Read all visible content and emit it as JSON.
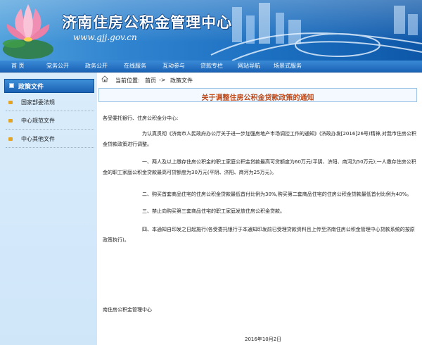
{
  "header": {
    "title": "济南住房公积金管理中心",
    "url": "www.gjj.gov.cn"
  },
  "nav": {
    "items": [
      "首 页",
      "党务公开",
      "政务公开",
      "在线服务",
      "互动参与",
      "贷款专栏",
      "网站导航",
      "场景式服务"
    ]
  },
  "sidebar": {
    "heading": "政策文件",
    "items": [
      "国家部委法规",
      "中心规范文件",
      "中心其他文件"
    ]
  },
  "breadcrumb": {
    "prefix": "当前位置:",
    "home": "首页",
    "separator": "->",
    "current": "政策文件"
  },
  "article": {
    "title": "关于调整住房公积金贷款政策的通知",
    "salutation": "各受委托银行、住房公积金分中心:",
    "intro": "为认真贯彻《济南市人民政府办公厅关于进一步加强房地产市场调控工作的通知》(济政办发[2016]26号)精神,对我市住房公积金贷款政策进行调整。",
    "items": [
      "一、两人及以上缴存住房公积金的职工家庭公积金贷款最高可贷额度为60万元(平阴、济阳、商河为50万元);一人缴存住房公积金的职工家庭公积金贷款最高可贷额度为30万元(平阴、济阳、商河为25万元)。",
      "二、购买首套商品住宅的住房公积金贷款最低首付比例为30%,购买第二套商品住宅的住房公积金贷款最低首付比例为40%。",
      "三、禁止向购买第三套商品住宅的职工家庭发放住房公积金贷款。",
      "四、本通知自印发之日起施行(各受委托银行于本通知印发前已受理贷款资料且上传至济南住房公积金管理中心贷款系统的按原政策执行)。"
    ],
    "signature": "南住房公积金管理中心",
    "date": "2016年10月2日"
  },
  "colors": {
    "banner": "#1c6fc0",
    "nav": "#1b63b6",
    "sidebar_bg": "#d9ecfb",
    "title_text": "#c04a1a"
  },
  "icons": [
    "lotus-logo",
    "home-icon",
    "bullet-icon"
  ]
}
